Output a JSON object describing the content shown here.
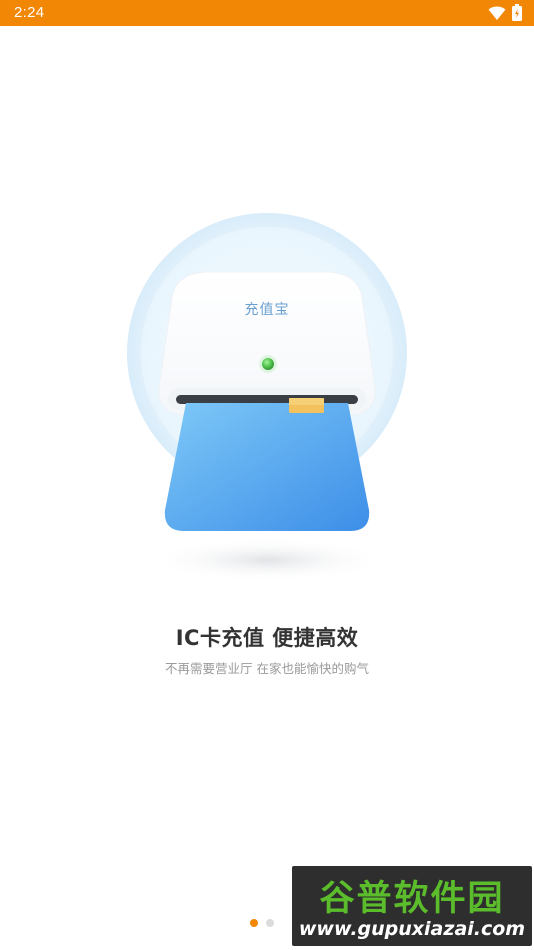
{
  "status_bar": {
    "time": "2:24",
    "background": "#f28705",
    "icons": [
      "wifi-icon",
      "battery-icon"
    ]
  },
  "illustration": {
    "device_label": "充值宝",
    "led_color": "#4caf50",
    "card_color": "#5aa9f2"
  },
  "onboarding": {
    "title": "IC卡充值 便捷高效",
    "subtitle": "不再需要营业厅 在家也能愉快的购气",
    "page_count": 2,
    "active_page": 1
  },
  "watermark": {
    "brand": "谷普软件园",
    "url": "www.gupuxiazai.com"
  }
}
